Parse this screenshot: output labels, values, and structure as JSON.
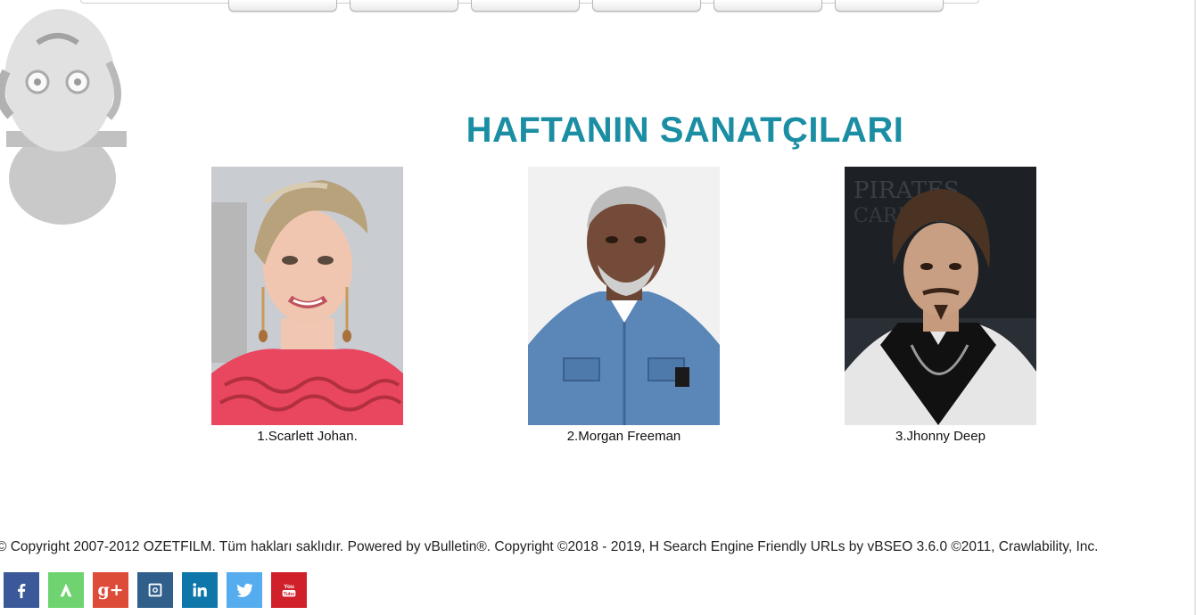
{
  "nav": {
    "tabs": [
      "",
      "",
      "",
      "",
      "",
      ""
    ]
  },
  "section": {
    "title": "HAFTANIN SANATÇILARI"
  },
  "artists": [
    {
      "caption": "1.Scarlett Johan."
    },
    {
      "caption": "2.Morgan Freeman"
    },
    {
      "caption": "3.Jhonny Deep"
    }
  ],
  "footer": {
    "copyright": "© Copyright 2007-2012 OZETFILM. Tüm hakları saklıdır. Powered by vBulletin®. Copyright ©2018 - 2019, H Search Engine Friendly URLs by vBSEO 3.6.0 ©2011, Crawlability, Inc."
  },
  "social": [
    {
      "icon": "facebook-icon",
      "color": "#3b5998"
    },
    {
      "icon": "vine-icon",
      "color": "#6fd36f"
    },
    {
      "icon": "google-plus-icon",
      "color": "#dd4b39",
      "label": "g+"
    },
    {
      "icon": "instagram-icon",
      "color": "#2f5f8a"
    },
    {
      "icon": "linkedin-icon",
      "color": "#0e76a8"
    },
    {
      "icon": "twitter-icon",
      "color": "#55acee"
    },
    {
      "icon": "youtube-icon",
      "color": "#d0202a",
      "label": "You Tube"
    }
  ]
}
